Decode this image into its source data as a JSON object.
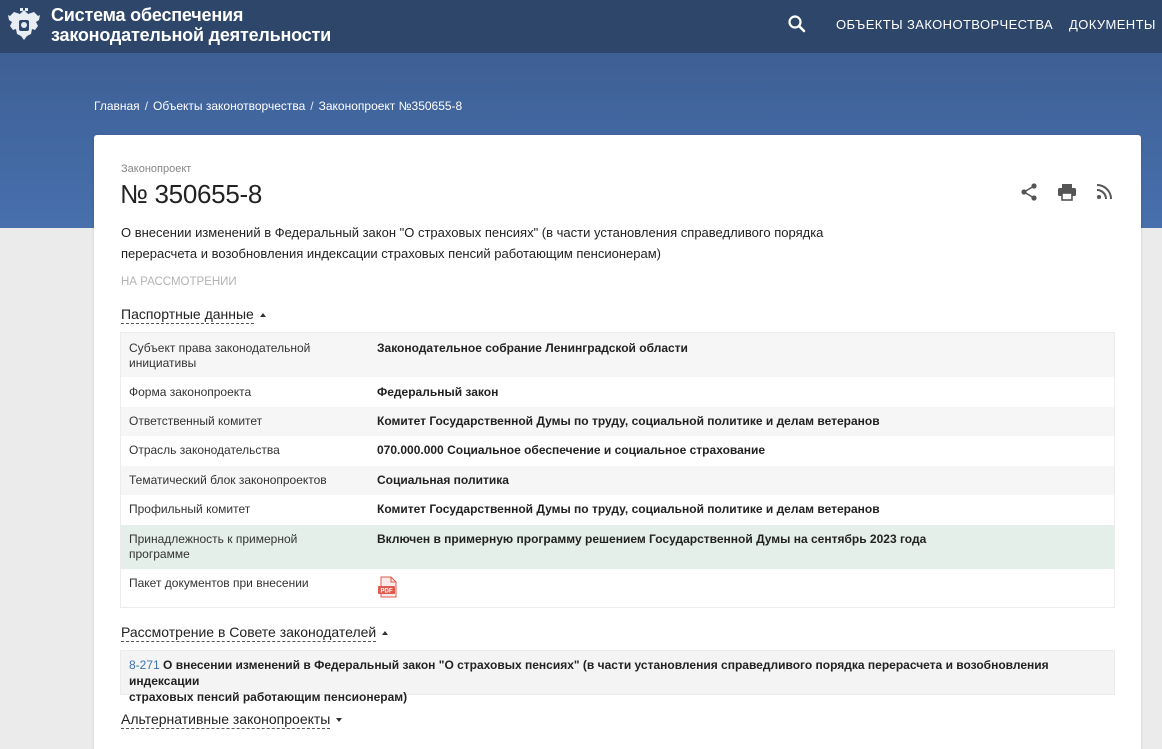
{
  "header": {
    "title_line1": "Система обеспечения",
    "title_line2": "законодательной деятельности",
    "nav": [
      "ОБЪЕКТЫ ЗАКОНОТВОРЧЕСТВА",
      "ДОКУМЕНТЫ"
    ]
  },
  "breadcrumb": [
    "Главная",
    "Объекты законотворчества",
    "Законопроект №350655-8"
  ],
  "bill": {
    "kind": "Законопроект",
    "number": "№ 350655-8",
    "description_line1": "О внесении изменений в Федеральный закон \"О страховых пенсиях\" (в части установления справедливого порядка",
    "description_line2": "перерасчета и возобновления индексации страховых пенсий работающим пенсионерам)",
    "status": "НА РАССМОТРЕНИИ"
  },
  "passport": {
    "title": "Паспортные данные",
    "rows": [
      {
        "label_1": "Субъект права законодательной",
        "label_2": "инициативы",
        "value": "Законодательное собрание Ленинградской области"
      },
      {
        "label_1": "Форма законопроекта",
        "label_2": "",
        "value": "Федеральный закон"
      },
      {
        "label_1": "Ответственный комитет",
        "label_2": "",
        "value": "Комитет Государственной Думы по труду, социальной политике и делам ветеранов"
      },
      {
        "label_1": "Отрасль законодательства",
        "label_2": "",
        "value": "070.000.000 Социальное обеспечение и социальное страхование"
      },
      {
        "label_1": "Тематический блок законопроектов",
        "label_2": "",
        "value": "Социальная политика"
      },
      {
        "label_1": "Профильный комитет",
        "label_2": "",
        "value": "Комитет Государственной Думы по труду, социальной политике и делам ветеранов"
      },
      {
        "label_1": "Принадлежность к примерной",
        "label_2": "программе",
        "value": "Включен в примерную программу решением Государственной Думы на сентябрь 2023 года"
      },
      {
        "label_1": "Пакет документов при внесении",
        "label_2": "",
        "value": "",
        "icon": "pdf-icon"
      }
    ]
  },
  "council": {
    "title": "Рассмотрение в Совете законодателей",
    "link": "8-271",
    "text_line1": "О внесении изменений в Федеральный закон \"О страховых пенсиях\" (в части установления справедливого порядка перерасчета и возобновления индексации",
    "text_line2": "страховых пенсий работающим пенсионерам)"
  },
  "alternatives": {
    "title": "Альтернативные законопроекты"
  },
  "icons": {
    "search": "search-icon",
    "share": "share-icon",
    "print": "print-icon",
    "rss": "rss-icon",
    "emblem": "coat-of-arms-icon"
  },
  "colors": {
    "topbar": "#2d4669",
    "hero": "#4770ad",
    "link": "#3d72b9",
    "highlight_row": "#e4efe9",
    "pdf": "#e05a4f"
  }
}
